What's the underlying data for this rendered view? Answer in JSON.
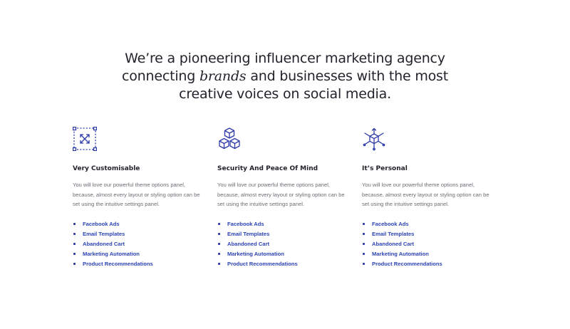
{
  "headline": {
    "line1": "We’re a pioneering influencer marketing agency",
    "line2_before": "connecting ",
    "line2_accent": "brands",
    "line2_after": " and businesses with the most",
    "line3": "creative voices on social media."
  },
  "colors": {
    "accent": "#2c44b4",
    "heading": "#23232b",
    "body": "#6e6e76"
  },
  "features": [
    {
      "icon": "expand-arrows-icon",
      "title": "Very Customisable",
      "description": "You will love our powerful theme options panel, because, almost every layout or styling option can be set using the intuitive settings panel.",
      "links": [
        "Facebook Ads",
        "Email Templates",
        "Abandoned Cart",
        "Marketing Automation",
        "Product Recommendations"
      ]
    },
    {
      "icon": "cubes-icon",
      "title": "Security And Peace Of Mind",
      "description": "You will love our powerful theme options panel, because, almost every layout or styling option can be set using the intuitive settings panel.",
      "links": [
        "Facebook Ads",
        "Email Templates",
        "Abandoned Cart",
        "Marketing Automation",
        "Product Recommendations"
      ]
    },
    {
      "icon": "cube-network-icon",
      "title": "It’s Personal",
      "description": "You will love our powerful theme options panel, because, almost every layout or styling option can be set using the intuitive settings panel.",
      "links": [
        "Facebook Ads",
        "Email Templates",
        "Abandoned Cart",
        "Marketing Automation",
        "Product Recommendations"
      ]
    }
  ]
}
